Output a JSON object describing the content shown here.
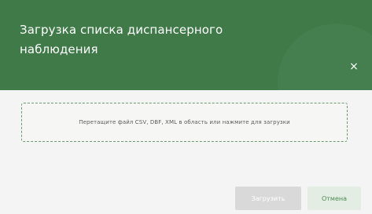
{
  "dialog": {
    "title": "Загрузка списка диспансерного наблюдения",
    "close_glyph": "×"
  },
  "dropzone": {
    "text": "Перетащите файл CSV, DBF, XML в область или нажмите для загрузки"
  },
  "footer": {
    "upload_label": "Загрузить",
    "cancel_label": "Отмена"
  },
  "colors": {
    "header_bg": "#3f7a48",
    "body_bg": "#f4f4f4",
    "upload_disabled_bg": "#d9d9d9",
    "cancel_bg": "#e3ede3",
    "cancel_text": "#4c8a53"
  }
}
